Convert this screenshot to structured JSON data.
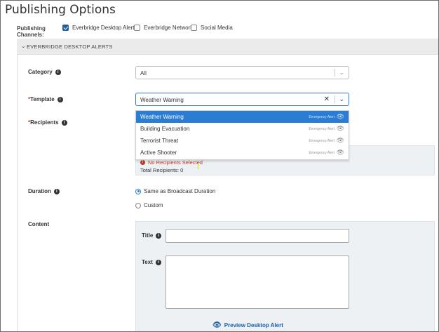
{
  "page": {
    "title": "Publishing Options"
  },
  "channels": {
    "label_line1": "Publishing",
    "label_line2": "Channels:",
    "options": [
      {
        "label": "Everbridge Desktop Alerts",
        "checked": true
      },
      {
        "label": "Everbridge Network",
        "checked": false
      },
      {
        "label": "Social Media",
        "checked": false
      }
    ]
  },
  "section": {
    "title": "EVERBRIDGE DESKTOP ALERTS"
  },
  "category": {
    "label": "Category",
    "value": "All"
  },
  "template": {
    "required_mark": "*",
    "label": "Template",
    "value": "Weather Warning",
    "options": [
      {
        "name": "Weather Warning",
        "tag": "Emergency Alert",
        "selected": true
      },
      {
        "name": "Building Evacuation",
        "tag": "Emergency Alert",
        "selected": false
      },
      {
        "name": "Terrorist Threat",
        "tag": "Emergency Alert",
        "selected": false
      },
      {
        "name": "Active Shooter",
        "tag": "Emergency Alert",
        "selected": false
      }
    ]
  },
  "recipients": {
    "required_mark": "*",
    "label": "Recipients",
    "error": "No Recipients Selected",
    "total": "Total Recipients: 0"
  },
  "duration": {
    "label": "Duration",
    "options": [
      {
        "label": "Same as Broadcast Duration",
        "checked": true
      },
      {
        "label": "Custom",
        "checked": false
      }
    ]
  },
  "content": {
    "label": "Content",
    "title_label": "Title",
    "title_value": "",
    "text_label": "Text",
    "text_value": "",
    "preview_label": "Preview Desktop Alert"
  },
  "colors": {
    "accent": "#2b7cd3",
    "checkbox": "#1a5ea8",
    "error": "#c0392b",
    "panel": "#eef1f4"
  }
}
